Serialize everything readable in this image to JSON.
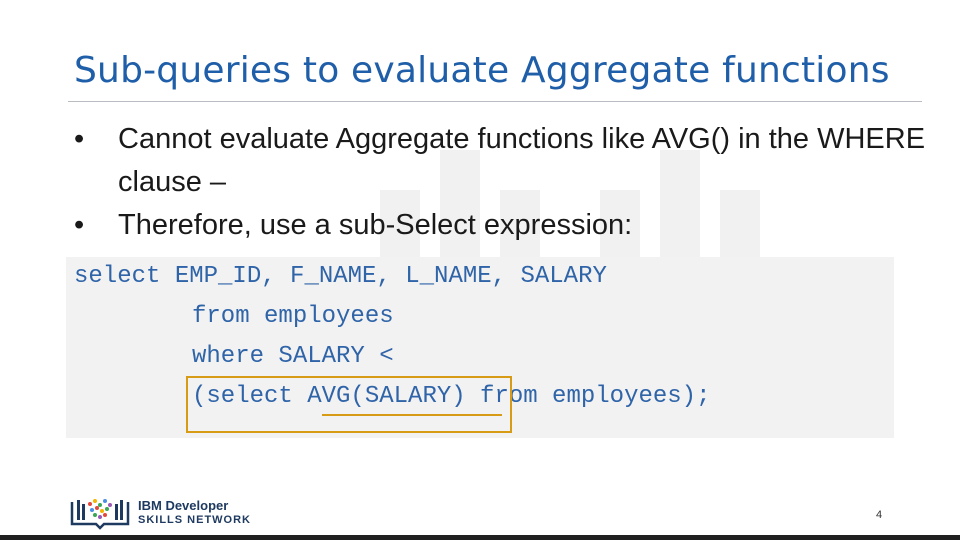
{
  "slide": {
    "title": "Sub-queries to evaluate Aggregate functions",
    "bullets": [
      "Cannot evaluate Aggregate functions like AVG() in the WHERE clause –",
      "Therefore, use a sub-Select expression:"
    ],
    "bullet_marker": "•",
    "code": {
      "line1": "select EMP_ID, F_NAME, L_NAME, SALARY",
      "line2": "from employees",
      "line3": "where SALARY <",
      "line4": "(select AVG(SALARY) from employees);"
    },
    "highlight_color": "#d79b16",
    "title_color": "#1f5ea8",
    "code_color": "#2f64a8"
  },
  "footer": {
    "brand_line1": "IBM Developer",
    "brand_line2": "SKILLS NETWORK",
    "page_number": "4"
  }
}
